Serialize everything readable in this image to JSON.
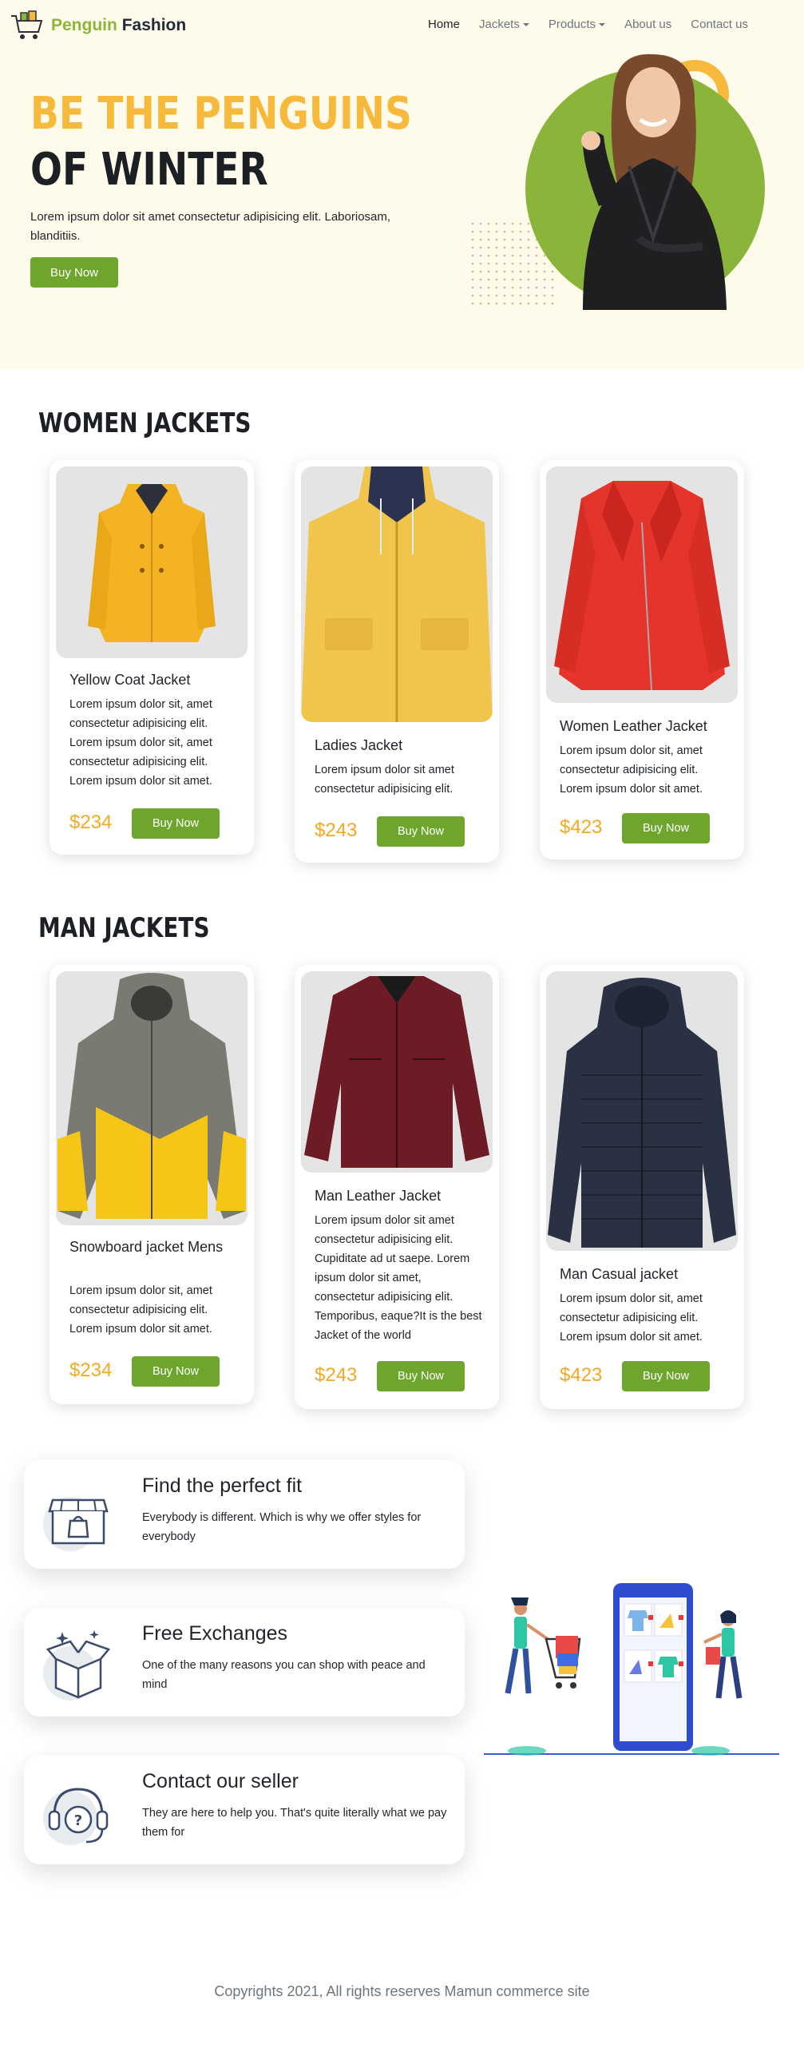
{
  "brand": {
    "name_part1": "Penguin",
    "name_part2": "Fashion"
  },
  "nav": {
    "items": [
      {
        "label": "Home"
      },
      {
        "label": "Jackets"
      },
      {
        "label": "Products"
      },
      {
        "label": "About us"
      },
      {
        "label": "Contact us"
      }
    ]
  },
  "hero": {
    "title_line1": "BE THE PENGUINS",
    "title_line2": "OF WINTER",
    "text": "Lorem ipsum dolor sit amet consectetur adipisicing elit. Laboriosam, blanditiis.",
    "button": "Buy Now"
  },
  "women": {
    "heading": "WOMEN JACKETS",
    "cards": [
      {
        "title": "Yellow Coat Jacket",
        "desc": "Lorem ipsum dolor sit, amet consectetur adipisicing elit. Lorem ipsum dolor sit, amet consectetur adipisicing elit. Lorem ipsum dolor sit amet.",
        "price": "$234",
        "button": "Buy Now"
      },
      {
        "title": "Ladies Jacket",
        "desc": "Lorem ipsum dolor sit amet consectetur adipisicing elit.",
        "price": "$243",
        "button": "Buy Now"
      },
      {
        "title": "Women Leather Jacket",
        "desc": "Lorem ipsum dolor sit, amet consectetur adipisicing elit. Lorem ipsum dolor sit amet.",
        "price": "$423",
        "button": "Buy Now"
      }
    ]
  },
  "men": {
    "heading": "MAN JACKETS",
    "cards": [
      {
        "title": "Snowboard jacket Mens",
        "desc": "Lorem ipsum dolor sit, amet consectetur adipisicing elit. Lorem ipsum dolor sit amet.",
        "price": "$234",
        "button": "Buy Now"
      },
      {
        "title": "Man Leather Jacket",
        "desc": "Lorem ipsum dolor sit amet consectetur adipisicing elit. Cupiditate ad ut saepe. Lorem ipsum dolor sit amet, consectetur adipisicing elit. Temporibus, eaque?It is the best Jacket of the world",
        "price": "$243",
        "button": "Buy Now"
      },
      {
        "title": "Man Casual jacket",
        "desc": "Lorem ipsum dolor sit, amet consectetur adipisicing elit. Lorem ipsum dolor sit amet.",
        "price": "$423",
        "button": "Buy Now"
      }
    ]
  },
  "features": [
    {
      "icon": "store-icon",
      "title": "Find the perfect fit",
      "text": "Everybody is different. Which is why we offer styles for everybody"
    },
    {
      "icon": "box-icon",
      "title": "Free Exchanges",
      "text": "One of the many reasons you can shop with peace and mind"
    },
    {
      "icon": "support-icon",
      "title": "Contact our seller",
      "text": "They are here to help you. That's quite literally what we pay them for"
    }
  ],
  "footer": {
    "text": "Copyrights 2021, All rights reserves Mamun commerce site"
  },
  "colors": {
    "accent_green": "#6ea52c",
    "accent_yellow": "#f6b93b",
    "price_orange": "#f6a823",
    "hero_bg": "#fffbeb"
  }
}
